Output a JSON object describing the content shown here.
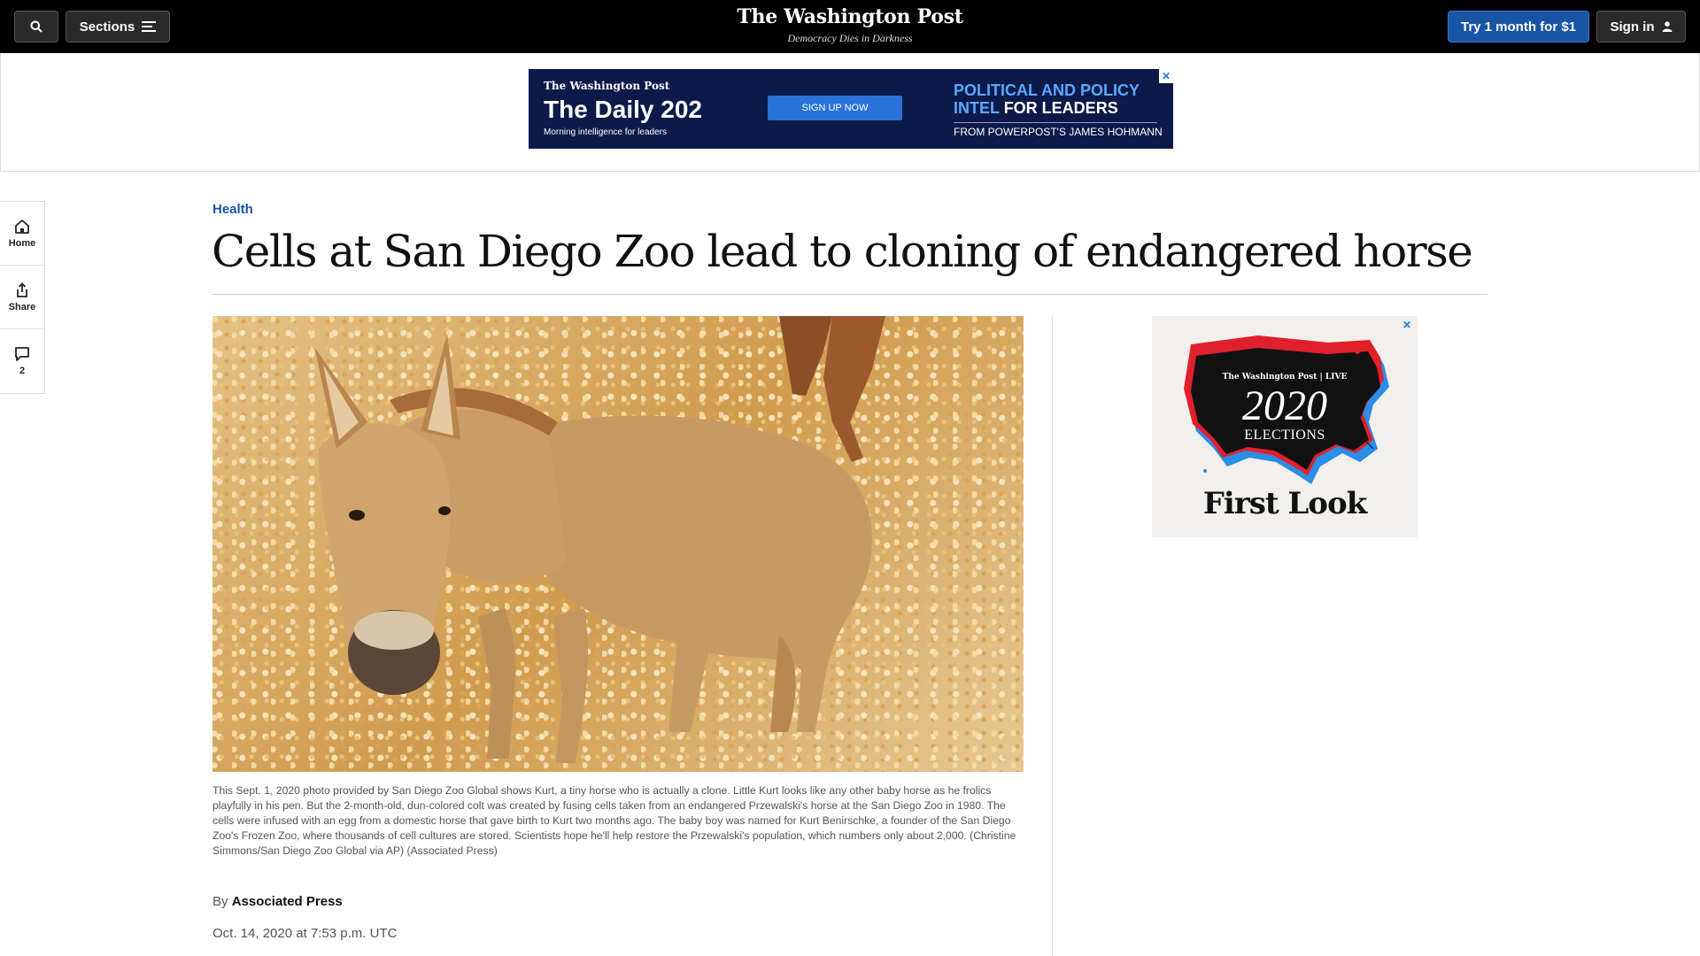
{
  "topbar": {
    "sections_label": "Sections",
    "logo": "The Washington Post",
    "tagline": "Democracy Dies in Darkness",
    "try_label": "Try 1 month for $1",
    "signin_label": "Sign in"
  },
  "top_ad": {
    "logo": "The Washington Post",
    "title": "The Daily 202",
    "subtitle": "Morning intelligence for leaders",
    "cta": "SIGN UP NOW",
    "right_line1": "POLITICAL AND POLICY",
    "right_line2_blue": "INTEL",
    "right_line2_white": "FOR LEADERS",
    "right_line3": "FROM POWERPOST'S JAMES HOHMANN"
  },
  "rail": {
    "home_label": "Home",
    "share_label": "Share",
    "comments_count": "2"
  },
  "article": {
    "kicker": "Health",
    "headline": "Cells at San Diego Zoo lead to cloning of endangered horse",
    "caption": "This Sept. 1, 2020 photo provided by San Diego Zoo Global shows Kurt, a tiny horse who is actually a clone. Little Kurt looks like any other baby horse as he frolics playfully in his pen. But the 2-month-old, dun-colored colt was created by fusing cells taken from an endangered Przewalski's horse at the San Diego Zoo in 1980. The cells were infused with an egg from a domestic horse that gave birth to Kurt two months ago. The baby boy was named for Kurt Benirschke, a founder of the San Diego Zoo's Frozen Zoo, where thousands of cell cultures are stored. Scientists hope he'll help restore the Przewalski's population, which numbers only about 2,000. (Christine Simmons/San Diego Zoo Global via AP) (Associated Press)",
    "byline_prefix": "By",
    "author": "Associated Press",
    "date": "Oct. 14, 2020 at 7:53 p.m. UTC"
  },
  "side_ad": {
    "logo": "The Washington Post | LIVE",
    "year": "2020",
    "word": "ELECTIONS",
    "title": "First Look"
  },
  "colors": {
    "accent": "#1955a5",
    "topbar": "#000000",
    "ad_navy": "#0c1a4a"
  }
}
